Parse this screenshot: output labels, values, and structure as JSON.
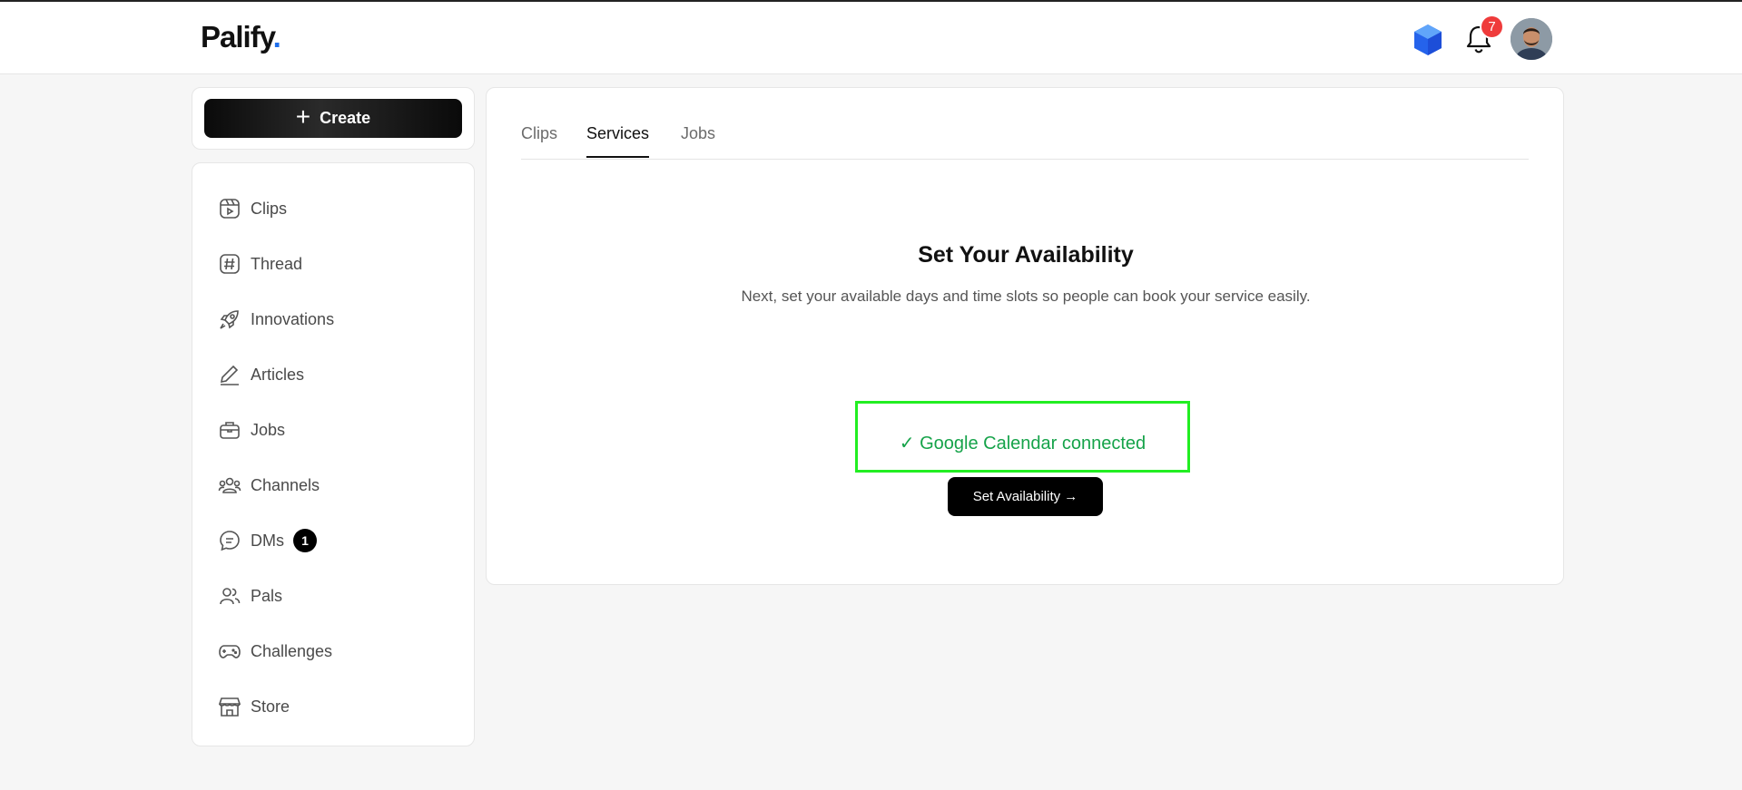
{
  "brand": {
    "name": "Palify",
    "dot": "."
  },
  "header": {
    "notification_count": "7",
    "icons": [
      "gem-icon",
      "bell-icon",
      "avatar"
    ]
  },
  "create": {
    "label": "Create",
    "icon": "plus-icon"
  },
  "sidebar": {
    "items": [
      {
        "label": "Clips",
        "icon": "clips-icon"
      },
      {
        "label": "Thread",
        "icon": "hashtag-icon"
      },
      {
        "label": "Innovations",
        "icon": "rocket-icon"
      },
      {
        "label": "Articles",
        "icon": "pen-icon"
      },
      {
        "label": "Jobs",
        "icon": "briefcase-icon"
      },
      {
        "label": "Channels",
        "icon": "users-icon"
      },
      {
        "label": "DMs",
        "icon": "chat-icon",
        "badge": "1"
      },
      {
        "label": "Pals",
        "icon": "user-group-icon"
      },
      {
        "label": "Challenges",
        "icon": "gamepad-icon"
      },
      {
        "label": "Store",
        "icon": "store-icon"
      }
    ]
  },
  "main": {
    "tabs": [
      {
        "label": "Clips",
        "active": false
      },
      {
        "label": "Services",
        "active": true
      },
      {
        "label": "Jobs",
        "active": false
      }
    ],
    "title": "Set Your Availability",
    "subtitle": "Next, set your available days and time slots so people can book your service easily.",
    "connected_status": "✓ Google Calendar connected",
    "set_availability_label": "Set Availability →"
  },
  "colors": {
    "accent": "#1f6feb",
    "success": "#16a34a",
    "highlight_border": "#22ee22",
    "badge_red": "#ef3b3b"
  }
}
